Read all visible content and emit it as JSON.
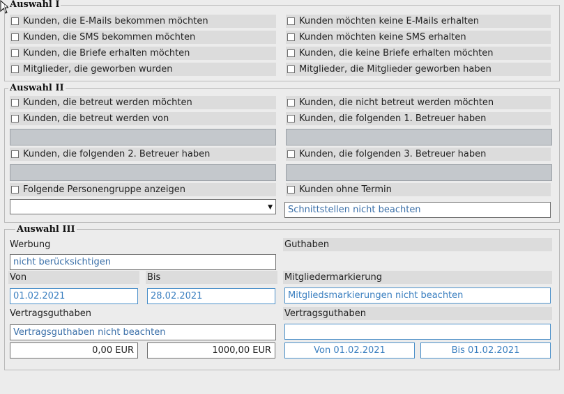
{
  "auswahl1": {
    "title": "Auswahl I",
    "left": [
      "Kunden, die E-Mails bekommen möchten",
      "Kunden, die SMS bekommen möchten",
      "Kunden, die Briefe erhalten möchten",
      "Mitglieder, die geworben wurden"
    ],
    "right": [
      "Kunden möchten keine E-Mails erhalten",
      "Kunden möchten keine SMS erhalten",
      "Kunden, die keine Briefe erhalten möchten",
      "Mitglieder, die Mitglieder geworben haben"
    ]
  },
  "auswahl2": {
    "title": "Auswahl II",
    "row1_left": "Kunden, die betreut werden möchten",
    "row1_right": "Kunden, die nicht betreut werden möchten",
    "row2_left": "Kunden, die betreut werden von",
    "row2_right": "Kunden, die folgenden 1. Betreuer haben",
    "row3_left": "Kunden, die folgenden 2. Betreuer haben",
    "row3_right": "Kunden, die folgenden 3. Betreuer haben",
    "row4_left": "Folgende Personengruppe anzeigen",
    "row4_right": "Kunden ohne Termin",
    "personengruppe_value": "",
    "schnittstellen_value": "Schnittstellen nicht beachten"
  },
  "auswahl3": {
    "title": "Auswahl III",
    "werbung_label": "Werbung",
    "werbung_value": "nicht berücksichtigen",
    "guthaben_label": "Guthaben",
    "von_label": "Von",
    "bis_label": "Bis",
    "von_value": "01.02.2021",
    "bis_value": "28.02.2021",
    "mitgliedermarkierung_label": "Mitgliedermarkierung",
    "mitgliedermarkierung_value": "Mitgliedsmarkierungen nicht beachten",
    "vertragsguthaben_left_label": "Vertragsguthaben",
    "vertragsguthaben_left_value": "Vertragsguthaben nicht beachten",
    "vertragsguthaben_right_label": "Vertragsguthaben",
    "vertragsguthaben_right_value": "",
    "amount_from": "0,00 EUR",
    "amount_to": "1000,00 EUR",
    "date_from_button": "Von 01.02.2021",
    "date_to_button": "Bis 01.02.2021"
  },
  "icons": {
    "cursor": "mouse-pointer-icon",
    "dropdown": "chevron-down-icon"
  },
  "colors": {
    "background": "#ececec",
    "row": "#dcdcdc",
    "disabled_field": "#c4c8cc",
    "accent_text": "#3a7fc0"
  }
}
